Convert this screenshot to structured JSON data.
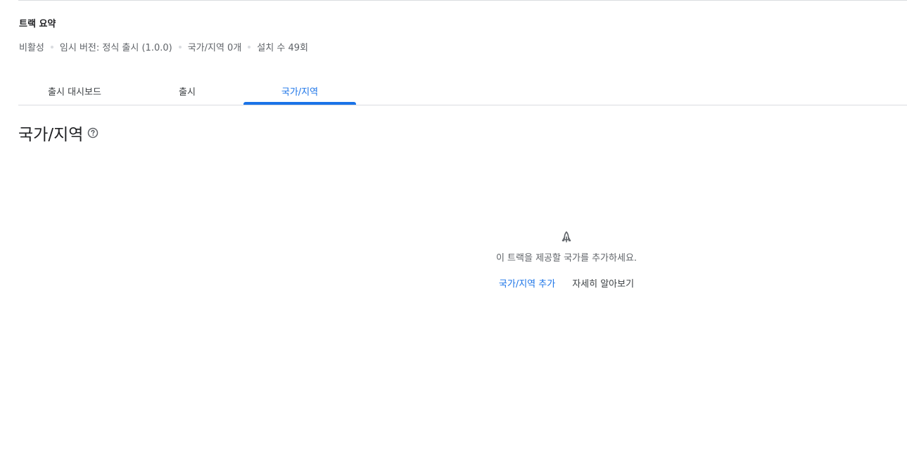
{
  "summary": {
    "title": "트랙 요약",
    "meta": [
      "비활성",
      "임시 버전: 정식 출시 (1.0.0)",
      "국가/지역 0개",
      "설치 수 49회"
    ]
  },
  "tabs": [
    {
      "label": "출시 대시보드",
      "active": false
    },
    {
      "label": "출시",
      "active": false
    },
    {
      "label": "국가/지역",
      "active": true
    }
  ],
  "section": {
    "heading": "국가/지역",
    "help_icon": "help-circle-icon"
  },
  "empty_state": {
    "icon": "rocket-icon",
    "message": "이 트랙을 제공할 국가를 추가하세요.",
    "primary_action": "국가/지역 추가",
    "secondary_action": "자세히 알아보기"
  },
  "colors": {
    "accent": "#1a73e8",
    "text_primary": "#202124",
    "text_secondary": "#5f6368",
    "divider": "#dadce0"
  }
}
